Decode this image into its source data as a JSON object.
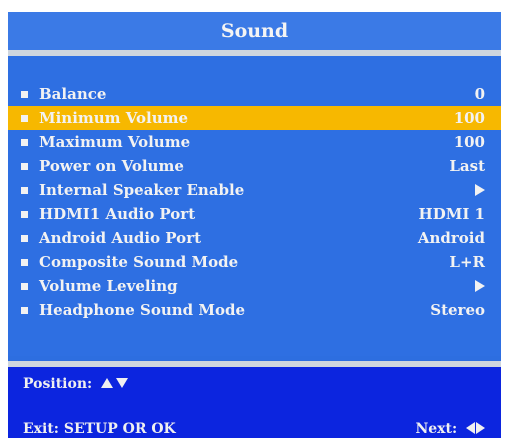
{
  "title": "Sound",
  "colors": {
    "panel": "#2e6fe2",
    "selected_row": "#f7b800",
    "footer": "#0c25df",
    "separator": "#cfd6de"
  },
  "menu": {
    "items": [
      {
        "label": "Balance",
        "value": "0",
        "selected": false
      },
      {
        "label": "Minimum Volume",
        "value": "100",
        "selected": true
      },
      {
        "label": "Maximum Volume",
        "value": "100",
        "selected": false
      },
      {
        "label": "Power on Volume",
        "value": "Last",
        "selected": false
      },
      {
        "label": "Internal Speaker Enable",
        "value": "",
        "value_icon": "arrow-right-icon",
        "selected": false
      },
      {
        "label": "HDMI1 Audio Port",
        "value": "HDMI 1",
        "selected": false
      },
      {
        "label": "Android Audio Port",
        "value": "Android",
        "selected": false
      },
      {
        "label": "Composite Sound Mode",
        "value": "L+R",
        "selected": false
      },
      {
        "label": "Volume Leveling",
        "value": "",
        "value_icon": "arrow-right-icon",
        "selected": false
      },
      {
        "label": "Headphone Sound Mode",
        "value": "Stereo",
        "selected": false
      }
    ]
  },
  "footer": {
    "position_label": "Position:",
    "position_icons": [
      "arrow-up-icon",
      "arrow-down-icon"
    ],
    "exit_label": "Exit:  SETUP OR OK",
    "next_label": "Next:",
    "next_icons": [
      "arrow-left-icon",
      "arrow-right-icon"
    ]
  }
}
